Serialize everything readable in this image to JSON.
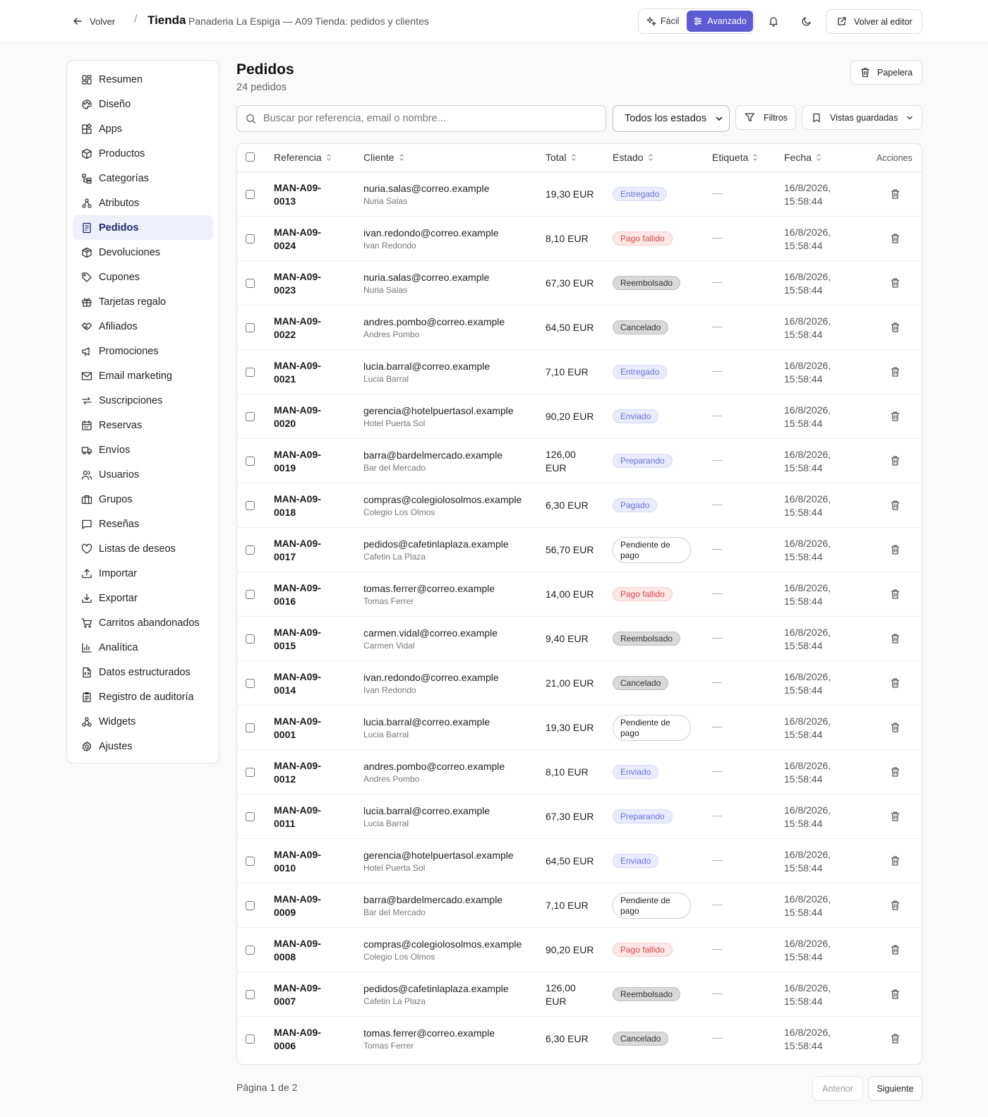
{
  "header": {
    "back_label": "Volver",
    "separator": "/",
    "title": "Tienda",
    "subtitle": "Panaderia La Espiga — A09 Tienda: pedidos y clientes",
    "mode_easy": "Fácil",
    "mode_advanced": "Avanzado",
    "editor_label": "Volver al editor",
    "accent_color": "#5b5bd6"
  },
  "sidebar": {
    "items": [
      {
        "label": "Resumen",
        "icon": "dashboard-icon"
      },
      {
        "label": "Diseño",
        "icon": "palette-icon"
      },
      {
        "label": "Apps",
        "icon": "apps-icon"
      },
      {
        "label": "Productos",
        "icon": "box-icon"
      },
      {
        "label": "Categorías",
        "icon": "categories-icon"
      },
      {
        "label": "Atributos",
        "icon": "attributes-icon"
      },
      {
        "label": "Pedidos",
        "icon": "orders-icon",
        "active": true
      },
      {
        "label": "Devoluciones",
        "icon": "returns-icon"
      },
      {
        "label": "Cupones",
        "icon": "tag-icon"
      },
      {
        "label": "Tarjetas regalo",
        "icon": "gift-icon"
      },
      {
        "label": "Afiliados",
        "icon": "handshake-icon"
      },
      {
        "label": "Promociones",
        "icon": "megaphone-icon"
      },
      {
        "label": "Email marketing",
        "icon": "mail-icon"
      },
      {
        "label": "Suscripciones",
        "icon": "repeat-icon"
      },
      {
        "label": "Reservas",
        "icon": "calendar-icon"
      },
      {
        "label": "Envíos",
        "icon": "truck-icon"
      },
      {
        "label": "Usuarios",
        "icon": "users-icon"
      },
      {
        "label": "Grupos",
        "icon": "briefcase-icon"
      },
      {
        "label": "Reseñas",
        "icon": "message-icon"
      },
      {
        "label": "Listas de deseos",
        "icon": "heart-icon"
      },
      {
        "label": "Importar",
        "icon": "upload-icon"
      },
      {
        "label": "Exportar",
        "icon": "download-icon"
      },
      {
        "label": "Carritos abandonados",
        "icon": "cart-icon"
      },
      {
        "label": "Analítica",
        "icon": "chart-icon"
      },
      {
        "label": "Datos estructurados",
        "icon": "file-code-icon"
      },
      {
        "label": "Registro de auditoría",
        "icon": "clipboard-icon"
      },
      {
        "label": "Widgets",
        "icon": "widgets-icon"
      },
      {
        "label": "Ajustes",
        "icon": "gear-icon"
      }
    ]
  },
  "main": {
    "title": "Pedidos",
    "count": "24 pedidos",
    "trash_label": "Papelera",
    "search_placeholder": "Buscar por referencia, email o nombre...",
    "status_filter": "Todos los estados",
    "filters_label": "Filtros",
    "saved_views_label": "Vistas guardadas"
  },
  "table": {
    "columns": {
      "ref": "Referencia",
      "client": "Cliente",
      "total": "Total",
      "status": "Estado",
      "tag": "Etiqueta",
      "date": "Fecha",
      "actions": "Acciones"
    },
    "rows": [
      {
        "ref": "MAN-A09-0013",
        "email": "nuria.salas@correo.example",
        "name": "Nuria Salas",
        "total": "19,30 EUR",
        "status": "Entregado",
        "tone": "blue",
        "tag": "—",
        "date": "16/8/2026, 15:58:44"
      },
      {
        "ref": "MAN-A09-0024",
        "email": "ivan.redondo@correo.example",
        "name": "Ivan Redondo",
        "total": "8,10 EUR",
        "status": "Pago fallido",
        "tone": "red",
        "tag": "—",
        "date": "16/8/2026, 15:58:44"
      },
      {
        "ref": "MAN-A09-0023",
        "email": "nuria.salas@correo.example",
        "name": "Nuria Salas",
        "total": "67,30 EUR",
        "status": "Reembolsado",
        "tone": "gray",
        "tag": "—",
        "date": "16/8/2026, 15:58:44"
      },
      {
        "ref": "MAN-A09-0022",
        "email": "andres.pombo@correo.example",
        "name": "Andres Pombo",
        "total": "64,50 EUR",
        "status": "Cancelado",
        "tone": "gray",
        "tag": "—",
        "date": "16/8/2026, 15:58:44"
      },
      {
        "ref": "MAN-A09-0021",
        "email": "lucia.barral@correo.example",
        "name": "Lucia Barral",
        "total": "7,10 EUR",
        "status": "Entregado",
        "tone": "blue",
        "tag": "—",
        "date": "16/8/2026, 15:58:44"
      },
      {
        "ref": "MAN-A09-0020",
        "email": "gerencia@hotelpuertasol.example",
        "name": "Hotel Puerta Sol",
        "total": "90,20 EUR",
        "status": "Enviado",
        "tone": "blue",
        "tag": "—",
        "date": "16/8/2026, 15:58:44"
      },
      {
        "ref": "MAN-A09-0019",
        "email": "barra@bardelmercado.example",
        "name": "Bar del Mercado",
        "total": "126,00 EUR",
        "status": "Preparando",
        "tone": "blue",
        "tag": "—",
        "date": "16/8/2026, 15:58:44"
      },
      {
        "ref": "MAN-A09-0018",
        "email": "compras@colegiolosolmos.example",
        "name": "Colegio Los Olmos",
        "total": "6,30 EUR",
        "status": "Pagado",
        "tone": "blue",
        "tag": "—",
        "date": "16/8/2026, 15:58:44"
      },
      {
        "ref": "MAN-A09-0017",
        "email": "pedidos@cafetinlaplaza.example",
        "name": "Cafetin La Plaza",
        "total": "56,70 EUR",
        "status": "Pendiente de pago",
        "tone": "white",
        "tag": "—",
        "date": "16/8/2026, 15:58:44"
      },
      {
        "ref": "MAN-A09-0016",
        "email": "tomas.ferrer@correo.example",
        "name": "Tomas Ferrer",
        "total": "14,00 EUR",
        "status": "Pago fallido",
        "tone": "red",
        "tag": "—",
        "date": "16/8/2026, 15:58:44"
      },
      {
        "ref": "MAN-A09-0015",
        "email": "carmen.vidal@correo.example",
        "name": "Carmen Vidal",
        "total": "9,40 EUR",
        "status": "Reembolsado",
        "tone": "gray",
        "tag": "—",
        "date": "16/8/2026, 15:58:44"
      },
      {
        "ref": "MAN-A09-0014",
        "email": "ivan.redondo@correo.example",
        "name": "Ivan Redondo",
        "total": "21,00 EUR",
        "status": "Cancelado",
        "tone": "gray",
        "tag": "—",
        "date": "16/8/2026, 15:58:44"
      },
      {
        "ref": "MAN-A09-0001",
        "email": "lucia.barral@correo.example",
        "name": "Lucia Barral",
        "total": "19,30 EUR",
        "status": "Pendiente de pago",
        "tone": "white",
        "tag": "—",
        "date": "16/8/2026, 15:58:44"
      },
      {
        "ref": "MAN-A09-0012",
        "email": "andres.pombo@correo.example",
        "name": "Andres Pombo",
        "total": "8,10 EUR",
        "status": "Enviado",
        "tone": "blue",
        "tag": "—",
        "date": "16/8/2026, 15:58:44"
      },
      {
        "ref": "MAN-A09-0011",
        "email": "lucia.barral@correo.example",
        "name": "Lucia Barral",
        "total": "67,30 EUR",
        "status": "Preparando",
        "tone": "blue",
        "tag": "—",
        "date": "16/8/2026, 15:58:44"
      },
      {
        "ref": "MAN-A09-0010",
        "email": "gerencia@hotelpuertasol.example",
        "name": "Hotel Puerta Sol",
        "total": "64,50 EUR",
        "status": "Enviado",
        "tone": "blue",
        "tag": "—",
        "date": "16/8/2026, 15:58:44"
      },
      {
        "ref": "MAN-A09-0009",
        "email": "barra@bardelmercado.example",
        "name": "Bar del Mercado",
        "total": "7,10 EUR",
        "status": "Pendiente de pago",
        "tone": "white",
        "tag": "—",
        "date": "16/8/2026, 15:58:44"
      },
      {
        "ref": "MAN-A09-0008",
        "email": "compras@colegiolosolmos.example",
        "name": "Colegio Los Olmos",
        "total": "90,20 EUR",
        "status": "Pago fallido",
        "tone": "red",
        "tag": "—",
        "date": "16/8/2026, 15:58:44"
      },
      {
        "ref": "MAN-A09-0007",
        "email": "pedidos@cafetinlaplaza.example",
        "name": "Cafetin La Plaza",
        "total": "126,00 EUR",
        "status": "Reembolsado",
        "tone": "gray",
        "tag": "—",
        "date": "16/8/2026, 15:58:44"
      },
      {
        "ref": "MAN-A09-0006",
        "email": "tomas.ferrer@correo.example",
        "name": "Tomas Ferrer",
        "total": "6,30 EUR",
        "status": "Cancelado",
        "tone": "gray",
        "tag": "—",
        "date": "16/8/2026, 15:58:44"
      }
    ]
  },
  "pagination": {
    "info": "Página 1 de 2",
    "prev_label": "Anterior",
    "next_label": "Siguiente"
  }
}
